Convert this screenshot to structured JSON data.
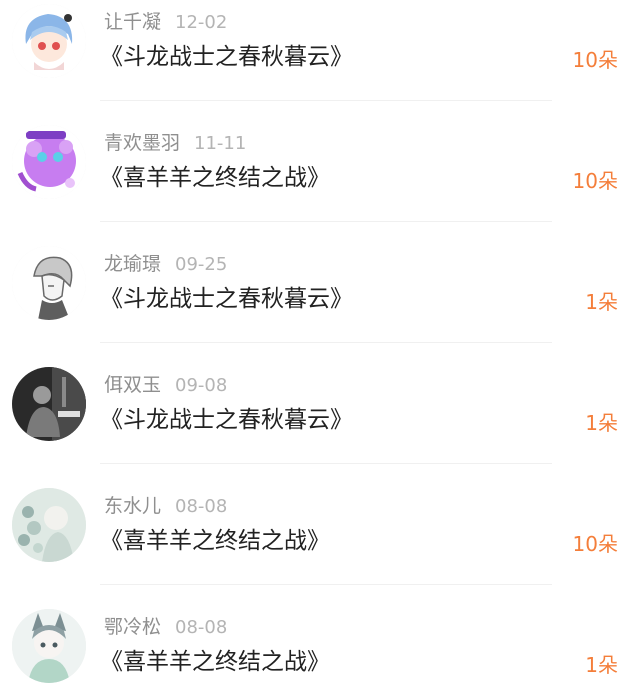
{
  "gifts": [
    {
      "name": "让千凝",
      "date": "12-02",
      "book": "《斗龙战士之春秋暮云》",
      "count": "10朵",
      "avatar": "anime-girl-blue-hair-avatar",
      "avatar_colors": [
        "#ffffff",
        "#8bb6e8",
        "#e05050"
      ]
    },
    {
      "name": "青欢墨羽",
      "date": "11-11",
      "book": "《喜羊羊之终结之战》",
      "count": "10朵",
      "avatar": "purple-blob-creature-avatar",
      "avatar_colors": [
        "#ffffff",
        "#c77df0",
        "#5ad0e8"
      ]
    },
    {
      "name": "龙瑜璟",
      "date": "09-25",
      "book": "《斗龙战士之春秋暮云》",
      "count": "1朵",
      "avatar": "sketch-anime-boy-avatar",
      "avatar_colors": [
        "#ffffff",
        "#6a6a6a",
        "#c8c8c8"
      ]
    },
    {
      "name": "佴双玉",
      "date": "09-08",
      "book": "《斗龙战士之春秋暮云》",
      "count": "1朵",
      "avatar": "monochrome-photo-avatar",
      "avatar_colors": [
        "#2a2a2a",
        "#9a9a9a",
        "#e0e0e0"
      ]
    },
    {
      "name": "东水儿",
      "date": "08-08",
      "book": "《喜羊羊之终结之战》",
      "count": "10朵",
      "avatar": "pastel-flower-girl-avatar",
      "avatar_colors": [
        "#dfe9e4",
        "#9ab3ae",
        "#f2f2ee"
      ]
    },
    {
      "name": "鄂冷松",
      "date": "08-08",
      "book": "《喜羊羊之终结之战》",
      "count": "1朵",
      "avatar": "wolf-ear-girl-avatar",
      "avatar_colors": [
        "#eef3f2",
        "#7c8f93",
        "#b2d6c7"
      ]
    }
  ]
}
